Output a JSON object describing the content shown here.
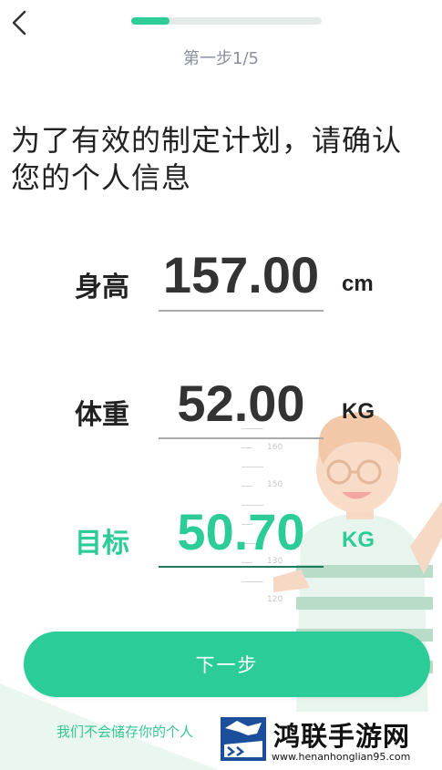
{
  "header": {
    "step_label": "第一步1/5",
    "progress": 0.2
  },
  "title": "为了有效的制定计划，请确认您的个人信息",
  "rows": {
    "height": {
      "label": "身高",
      "value": "157.00",
      "unit": "cm"
    },
    "weight": {
      "label": "体重",
      "value": "52.00",
      "unit": "KG"
    },
    "target": {
      "label": "目标",
      "value": "50.70",
      "unit": "KG"
    }
  },
  "ruler": {
    "labels": [
      "160",
      "150",
      "130",
      "120"
    ]
  },
  "next_button": "下一步",
  "footer_note": "我们不会储存你的个人",
  "watermark": {
    "title": "鸿联手游网",
    "url": "www.henanhonglian95.com"
  },
  "colors": {
    "accent": "#2bcc98",
    "text": "#222222",
    "muted": "#8a8f9c"
  }
}
